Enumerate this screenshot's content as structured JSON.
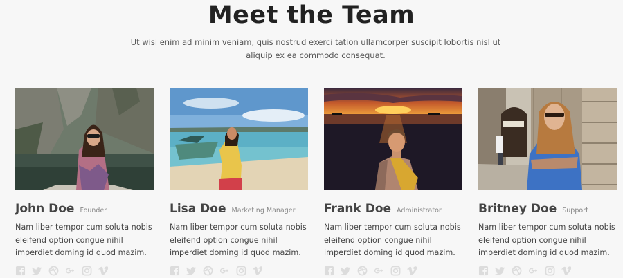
{
  "header": {
    "title": "Meet the Team",
    "subtitle": "Ut wisi enim ad minim veniam, quis nostrud exerci tation ullamcorper suscipit lobortis nisl ut aliquip ex ea commodo consequat."
  },
  "team": [
    {
      "name": "John Doe",
      "role": "Founder",
      "bio": "Nam liber tempor cum soluta nobis eleifend option congue nihil imperdiet doming id quod mazim.",
      "photo": "woman-sunglasses-cliffs-river"
    },
    {
      "name": "Lisa Doe",
      "role": "Marketing Manager",
      "bio": "Nam liber tempor cum soluta nobis eleifend option congue nihil imperdiet doming id quod mazim.",
      "photo": "woman-yellow-top-beach-boats"
    },
    {
      "name": "Frank Doe",
      "role": "Administrator",
      "bio": "Nam liber tempor cum soluta nobis eleifend option congue nihil imperdiet doming id quod mazim.",
      "photo": "man-sunset-sea"
    },
    {
      "name": "Britney Doe",
      "role": "Support",
      "bio": "Nam liber tempor cum soluta nobis eleifend option congue nihil imperdiet doming id quod mazim.",
      "photo": "woman-blue-top-street"
    }
  ],
  "social_icons": [
    "facebook-icon",
    "twitter-icon",
    "dribbble-icon",
    "google-plus-icon",
    "instagram-icon",
    "vimeo-icon"
  ],
  "colors": {
    "background": "#f7f7f7",
    "title": "#222222",
    "text": "#444444",
    "muted": "#888888",
    "icon": "#dcdcdc"
  }
}
